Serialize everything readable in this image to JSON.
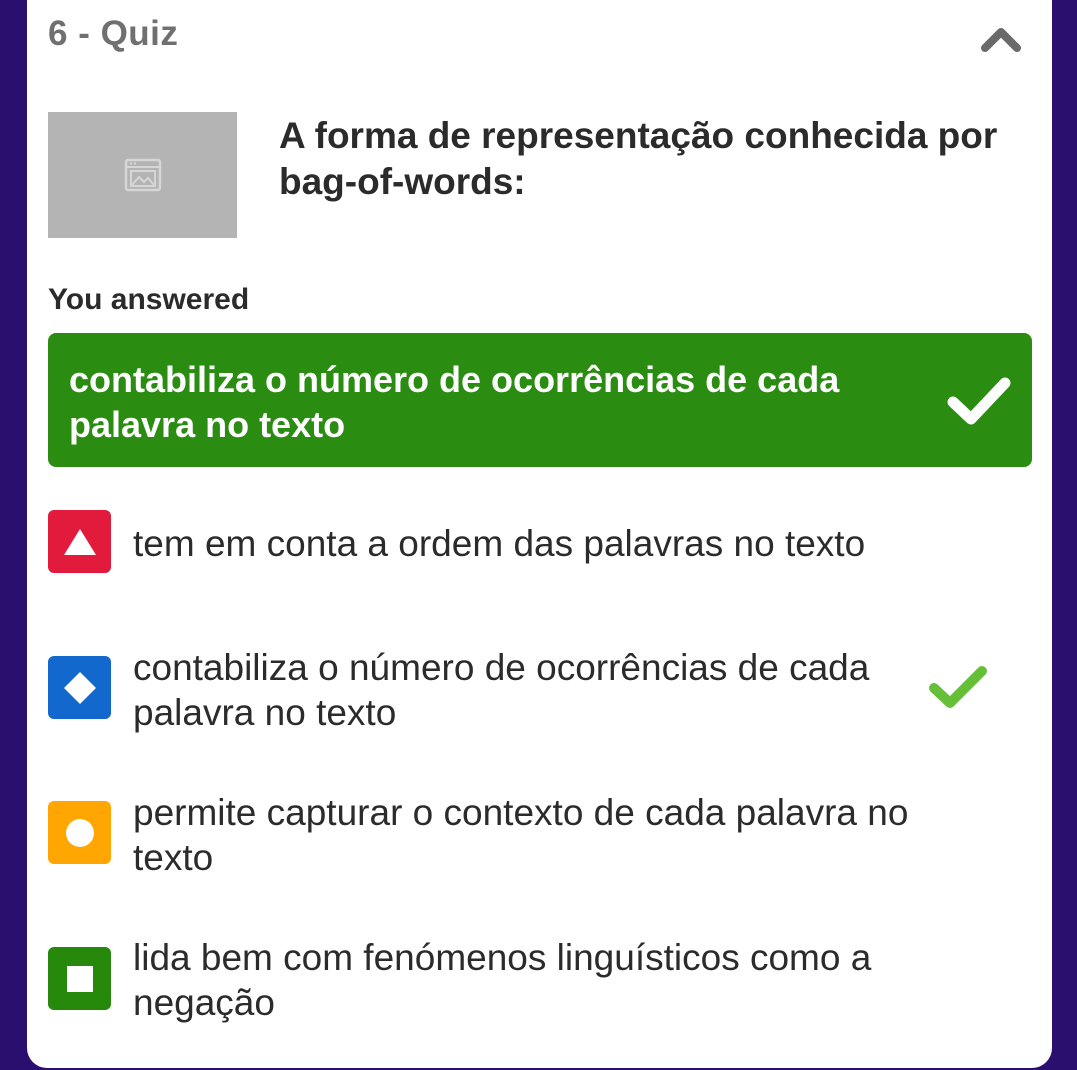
{
  "quiz": {
    "label": "6 - Quiz",
    "question": "A forma de representação conhecida por bag-of-words:",
    "image_placeholder_icon": "image-icon",
    "collapse_icon": "chevron-up-icon"
  },
  "answered": {
    "label": "You answered",
    "text": "contabiliza o número de ocorrências de cada palavra no texto",
    "status": "correct",
    "color": "#2b8c12"
  },
  "options": [
    {
      "shape": "triangle",
      "color": "#e21b3c",
      "text": "tem em conta a ordem das palavras no texto",
      "correct": false
    },
    {
      "shape": "diamond",
      "color": "#1368ce",
      "text": "contabiliza o número de ocorrências de cada palavra no texto",
      "correct": true
    },
    {
      "shape": "circle",
      "color": "#ffa602",
      "text": "permite capturar o contexto de cada palavra no texto",
      "correct": false
    },
    {
      "shape": "square",
      "color": "#26890c",
      "text": "lida bem com fenómenos linguísticos como a negação",
      "correct": false
    }
  ],
  "colors": {
    "background": "#2a0f6e",
    "correct_check": "#66bf39"
  }
}
